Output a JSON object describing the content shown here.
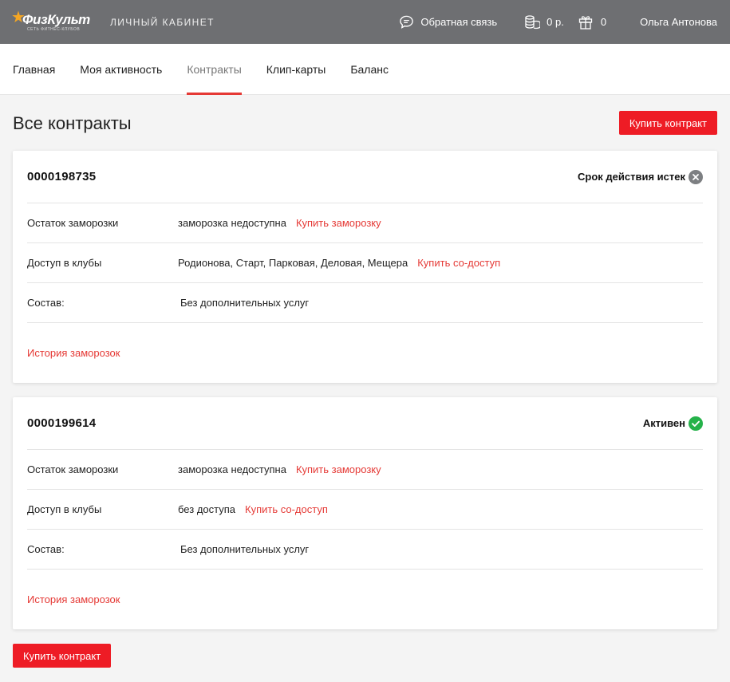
{
  "header": {
    "logo_text": "ФизКульт",
    "logo_sub": "сеть фитнес-клубов",
    "cabinet": "ЛИЧНЫЙ КАБИНЕТ",
    "feedback": "Обратная связь",
    "balance": "0 р.",
    "gifts": "0",
    "user": "Ольга Антонова"
  },
  "nav": {
    "tabs": [
      {
        "label": "Главная"
      },
      {
        "label": "Моя активность"
      },
      {
        "label": "Контракты"
      },
      {
        "label": "Клип-карты"
      },
      {
        "label": "Баланс"
      }
    ],
    "active": "Контракты"
  },
  "page": {
    "title": "Все контракты",
    "buy_contract": "Купить контракт",
    "buy_contract_bottom": "Купить контракт"
  },
  "labels": {
    "freeze": "Остаток заморозки",
    "clubs": "Доступ в клубы",
    "composition": "Состав:",
    "freeze_history": "История заморозок"
  },
  "contracts": [
    {
      "number": "0000198735",
      "status": "Срок действия истек",
      "freeze_value": "заморозка недоступна",
      "freeze_link": "Купить заморозку",
      "clubs_value": "Родионова, Старт, Парковая, Деловая, Мещера",
      "clubs_link": "Купить со-доступ",
      "composition_value": "Без дополнительных услуг"
    },
    {
      "number": "0000199614",
      "status": "Активен",
      "freeze_value": "заморозка недоступна",
      "freeze_link": "Купить заморозку",
      "clubs_value": "без доступа",
      "clubs_link": "Купить со-доступ",
      "composition_value": "Без дополнительных услуг"
    }
  ],
  "colors": {
    "topbar": "#6e6f72",
    "accent": "#ee1c25",
    "link": "#e53935",
    "active_status": "#25b24a",
    "expired_status": "#7d7f82"
  }
}
